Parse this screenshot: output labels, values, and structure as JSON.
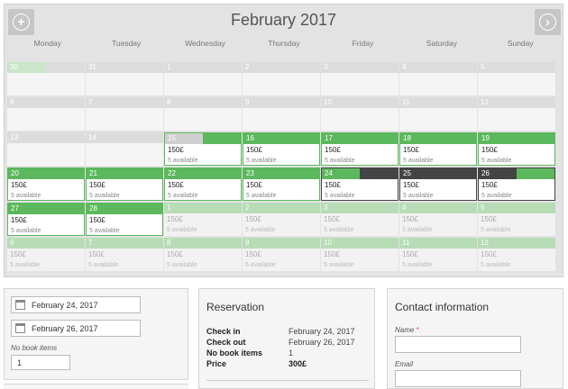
{
  "calendar": {
    "title": "February 2017",
    "prev_icon": "circle-plus-icon",
    "next_icon": "circle-arrow-right-icon",
    "weekdays": [
      "Monday",
      "Tuesday",
      "Wednesday",
      "Thursday",
      "Friday",
      "Saturday",
      "Sunday"
    ],
    "price": "150£",
    "availability": "5 available",
    "colors": {
      "available": "#5cb85c",
      "selected": "#444444",
      "next_month": "#b7dcb6",
      "unavailable": "#dddddd"
    },
    "weeks": [
      [
        {
          "d": "30",
          "s": "past",
          "mark": true
        },
        {
          "d": "31",
          "s": "past"
        },
        {
          "d": "1",
          "s": "past"
        },
        {
          "d": "2",
          "s": "past"
        },
        {
          "d": "3",
          "s": "past"
        },
        {
          "d": "4",
          "s": "past"
        },
        {
          "d": "5",
          "s": "past"
        }
      ],
      [
        {
          "d": "6",
          "s": "past"
        },
        {
          "d": "7",
          "s": "past"
        },
        {
          "d": "8",
          "s": "past"
        },
        {
          "d": "9",
          "s": "past"
        },
        {
          "d": "10",
          "s": "past"
        },
        {
          "d": "11",
          "s": "past"
        },
        {
          "d": "12",
          "s": "past"
        }
      ],
      [
        {
          "d": "13",
          "s": "past"
        },
        {
          "d": "14",
          "s": "past"
        },
        {
          "d": "15",
          "s": "avail",
          "half": "start"
        },
        {
          "d": "16",
          "s": "avail"
        },
        {
          "d": "17",
          "s": "avail"
        },
        {
          "d": "18",
          "s": "avail"
        },
        {
          "d": "19",
          "s": "avail"
        }
      ],
      [
        {
          "d": "20",
          "s": "avail"
        },
        {
          "d": "21",
          "s": "avail"
        },
        {
          "d": "22",
          "s": "avail"
        },
        {
          "d": "23",
          "s": "avail"
        },
        {
          "d": "24",
          "s": "selected",
          "half": "checkin"
        },
        {
          "d": "25",
          "s": "selected"
        },
        {
          "d": "26",
          "s": "selected",
          "half": "checkout"
        }
      ],
      [
        {
          "d": "27",
          "s": "avail"
        },
        {
          "d": "28",
          "s": "avail"
        },
        {
          "d": "1",
          "s": "next"
        },
        {
          "d": "2",
          "s": "next"
        },
        {
          "d": "3",
          "s": "next"
        },
        {
          "d": "4",
          "s": "next"
        },
        {
          "d": "5",
          "s": "next"
        }
      ],
      [
        {
          "d": "6",
          "s": "next"
        },
        {
          "d": "7",
          "s": "next"
        },
        {
          "d": "8",
          "s": "next"
        },
        {
          "d": "9",
          "s": "next"
        },
        {
          "d": "10",
          "s": "next"
        },
        {
          "d": "11",
          "s": "next"
        },
        {
          "d": "12",
          "s": "next"
        }
      ]
    ]
  },
  "dates_panel": {
    "checkin_value": "February 24, 2017",
    "checkout_value": "February 26, 2017",
    "items_label": "No book items",
    "items_value": "1",
    "calendar_icon": "calendar-icon"
  },
  "reservation": {
    "title": "Reservation",
    "rows": [
      {
        "label": "Check in",
        "value": "February 24, 2017"
      },
      {
        "label": "Check out",
        "value": "February 26, 2017"
      },
      {
        "label": "No book items",
        "value": "1"
      },
      {
        "label": "Price",
        "value": "300£"
      }
    ]
  },
  "contact": {
    "title": "Contact information",
    "name_label": "Name",
    "required_mark": "*",
    "email_label": "Email"
  }
}
